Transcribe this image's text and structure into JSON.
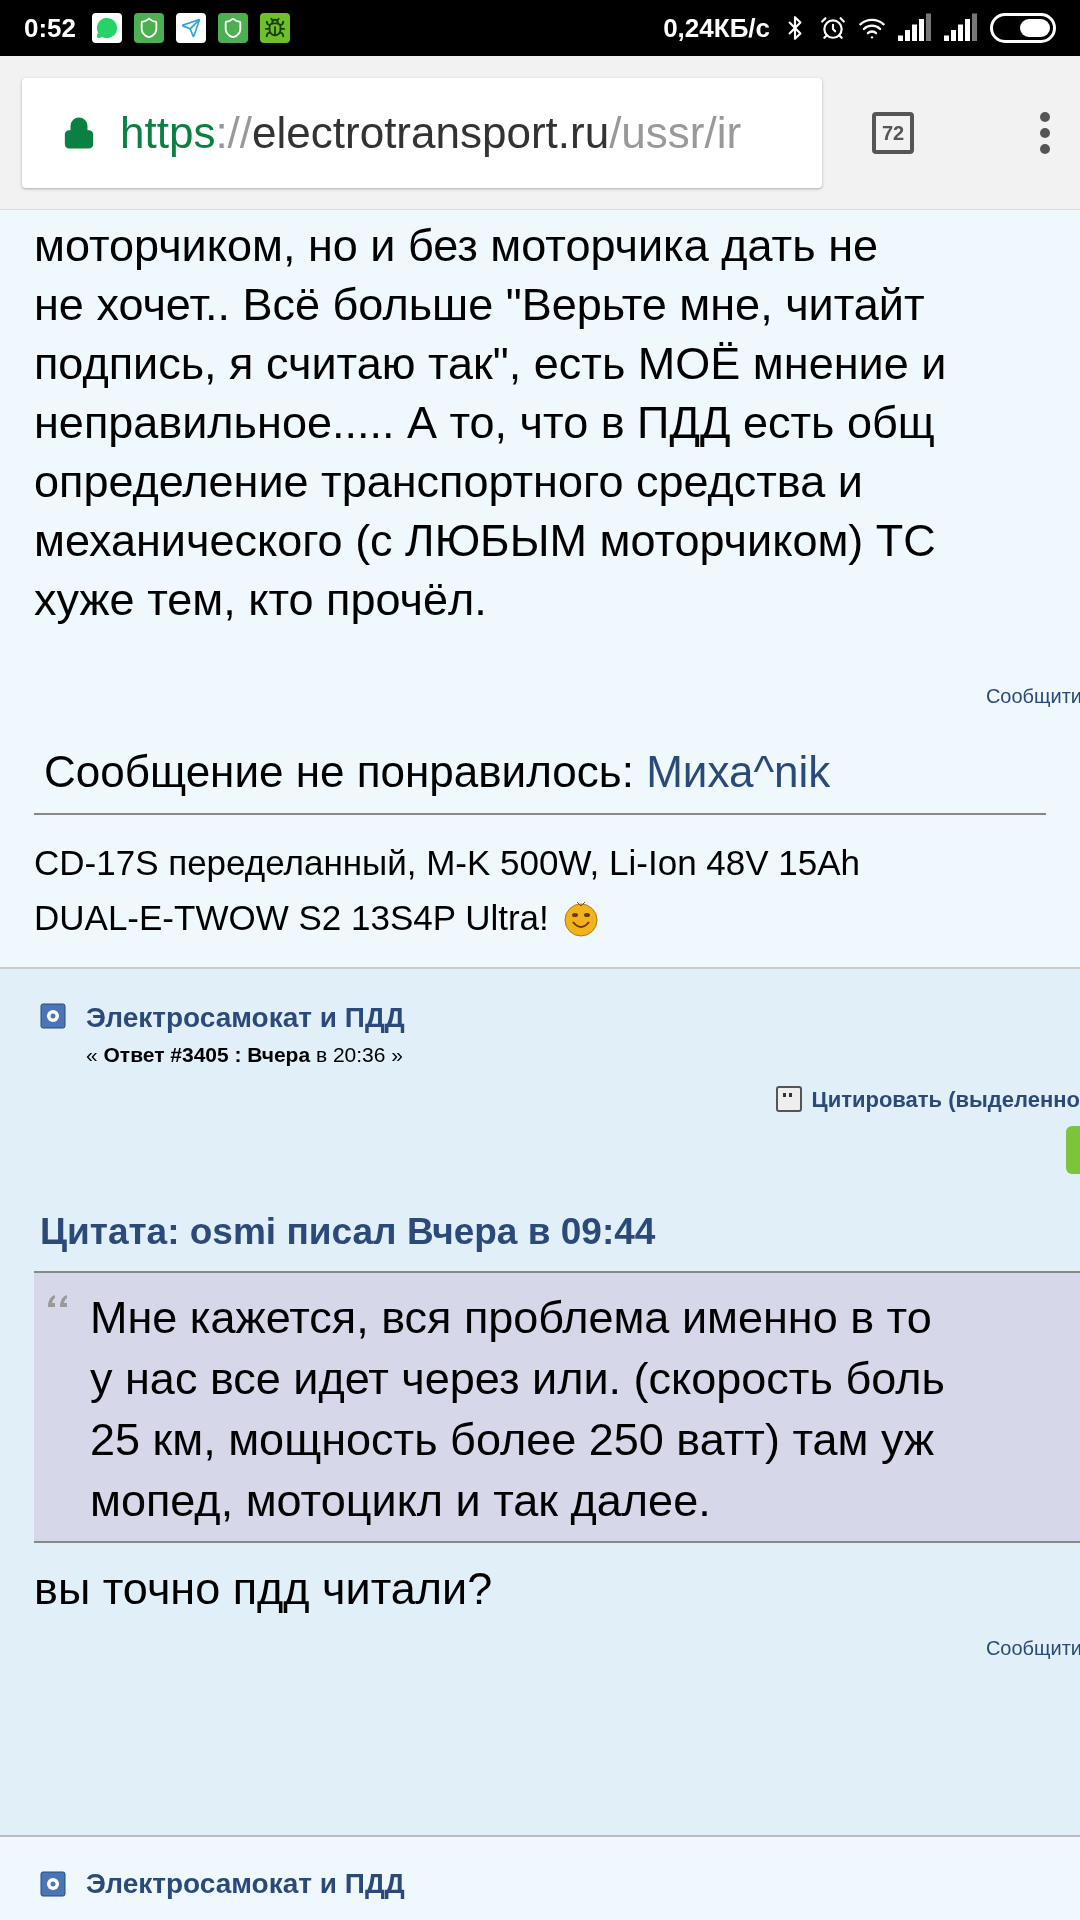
{
  "status_bar": {
    "time": "0:52",
    "network_speed": "0,24КБ/с"
  },
  "address_bar": {
    "scheme": "https",
    "separator": "://",
    "host": "electrotransport.ru",
    "path": "/ussr/ir",
    "tab_count": "72"
  },
  "post_1": {
    "body_lines": [
      "моторчиком, но и без моторчика дать не",
      "не хочет.. Всё больше \"Верьте мне, читайт",
      "подпись, я считаю так\", есть МОЁ мнение и",
      "неправильное..... А то, что в ПДД есть общ",
      "определение транспортного средства и",
      "механического (с ЛЮБЫМ моторчиком) ТС",
      "хуже тем, кто прочёл."
    ],
    "report_link": "Сообщити",
    "dislike": {
      "label": "Сообщение не понравилось:",
      "user": "Миха^nik"
    },
    "signature_lines": [
      "CD-17S переделанный, M-K 500W, Li-Ion 48V 15Ah",
      "DUAL-E-TWOW S2 13S4P Ultra!"
    ]
  },
  "post_2": {
    "title": "Электросамокат и ПДД",
    "meta": "« **Ответ #3405 : Вчера** в 20:36 »",
    "quote_button": "Цитировать (выделенно",
    "quote": {
      "header": "Цитата: osmi писал Вчера в 09:44",
      "lines": [
        "Мне кажется, вся проблема именно в то",
        "у нас все идет через или. (скорость боль",
        "25 км, мощность более 250 ватт)  там уж",
        "мопед, мотоцикл и так далее."
      ]
    },
    "body": "вы точно пдд читали?",
    "report_link": "Сообщити"
  },
  "post_3": {
    "title": "Электросамокат и ПДД"
  }
}
